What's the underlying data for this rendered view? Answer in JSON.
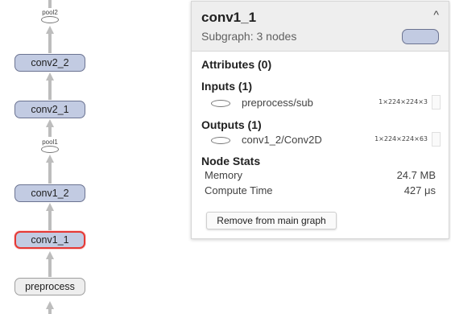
{
  "graph": {
    "nodes": {
      "pool2": "pool2",
      "conv2_2": "conv2_2",
      "conv2_1": "conv2_1",
      "pool1": "pool1",
      "conv1_2": "conv1_2",
      "conv1_1": "conv1_1",
      "preprocess": "preprocess"
    },
    "selected_node": "conv1_1"
  },
  "card": {
    "title": "conv1_1",
    "subtitle": "Subgraph: 3 nodes",
    "collapse_icon": "chevron-up-icon",
    "attributes_heading": "Attributes (0)",
    "inputs_heading": "Inputs (1)",
    "inputs": [
      {
        "name": "preprocess/sub",
        "shape": "1×224×224×3"
      }
    ],
    "outputs_heading": "Outputs (1)",
    "outputs": [
      {
        "name": "conv1_2/Conv2D",
        "shape": "1×224×224×63"
      }
    ],
    "stats_heading": "Node Stats",
    "stats": [
      {
        "label": "Memory",
        "value": "24.7 MB"
      },
      {
        "label": "Compute Time",
        "value": "427 μs"
      }
    ],
    "remove_button": "Remove from main graph"
  },
  "colors": {
    "node_fill": "#c2cbe2",
    "node_border": "#6b7391",
    "selected_border": "#e53935",
    "edge": "#bdbdbd"
  }
}
